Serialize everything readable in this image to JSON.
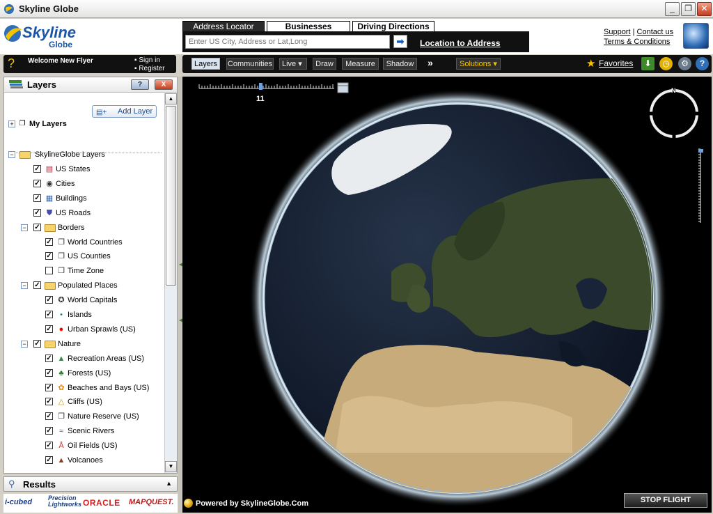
{
  "window": {
    "title": "Skyline Globe",
    "buttons": [
      "_",
      "❐",
      "✕"
    ]
  },
  "logo": {
    "brand": "Skyline",
    "sub": "Globe"
  },
  "search_tabs": [
    {
      "label": "Address Locator",
      "active": true
    },
    {
      "label": "Businesses",
      "active": false
    },
    {
      "label": "Driving Directions",
      "active": false
    }
  ],
  "address": {
    "placeholder": "Enter US City, Address or Lat,Long",
    "go": "➡",
    "link": "Location to Address"
  },
  "header_links": {
    "support": "Support",
    "separator": "|",
    "contact": "Contact us",
    "terms": "Terms & Conditions"
  },
  "welcome": {
    "text": "Welcome New Flyer",
    "sign_in": "Sign in",
    "register": "Register"
  },
  "toolbar": {
    "buttons": [
      "Layers",
      "Communities",
      "Live",
      "Draw",
      "Measure",
      "Shadow"
    ],
    "active": "Layers",
    "more": "»",
    "solutions": "Solutions",
    "favorites": "Favorites",
    "icons": [
      "download-icon",
      "clock-icon",
      "tools-icon",
      "help-icon"
    ]
  },
  "layers_panel": {
    "title": "Layers",
    "help_btn": "?",
    "close_btn": "X",
    "add_layer": "Add Layer",
    "my_layers": "My Layers",
    "root": "SkylineGlobe Layers",
    "items": [
      {
        "label": "US States",
        "checked": true,
        "icon": "us-flag-icon",
        "level": 1
      },
      {
        "label": "Cities",
        "checked": true,
        "icon": "target-icon",
        "level": 1
      },
      {
        "label": "Buildings",
        "checked": true,
        "icon": "building-icon",
        "level": 1
      },
      {
        "label": "US Roads",
        "checked": true,
        "icon": "shield-icon",
        "level": 1
      },
      {
        "label": "Borders",
        "checked": true,
        "icon": "folder-icon",
        "level": 1,
        "group": true
      },
      {
        "label": "World Countries",
        "checked": true,
        "icon": "layer-icon",
        "level": 2
      },
      {
        "label": "US Counties",
        "checked": true,
        "icon": "layer-icon",
        "level": 2
      },
      {
        "label": "Time Zone",
        "checked": false,
        "icon": "layer-icon",
        "level": 2
      },
      {
        "label": "Populated Places",
        "checked": true,
        "icon": "folder-icon",
        "level": 1,
        "group": true
      },
      {
        "label": "World Capitals",
        "checked": true,
        "icon": "star-icon",
        "level": 2
      },
      {
        "label": "Islands",
        "checked": true,
        "icon": "dot-icon",
        "level": 2
      },
      {
        "label": "Urban Sprawls (US)",
        "checked": true,
        "icon": "red-blob-icon",
        "level": 2
      },
      {
        "label": "Nature",
        "checked": true,
        "icon": "folder-icon",
        "level": 1,
        "group": true
      },
      {
        "label": "Recreation Areas (US)",
        "checked": true,
        "icon": "recreation-icon",
        "level": 2
      },
      {
        "label": "Forests (US)",
        "checked": true,
        "icon": "tree-icon",
        "level": 2
      },
      {
        "label": "Beaches and Bays (US)",
        "checked": true,
        "icon": "beach-icon",
        "level": 2
      },
      {
        "label": "Cliffs (US)",
        "checked": true,
        "icon": "cliff-icon",
        "level": 2
      },
      {
        "label": "Nature Reserve (US)",
        "checked": true,
        "icon": "layer-icon",
        "level": 2
      },
      {
        "label": "Scenic Rivers",
        "checked": true,
        "icon": "river-icon",
        "level": 2
      },
      {
        "label": "Oil Fields (US)",
        "checked": true,
        "icon": "oil-icon",
        "level": 2
      },
      {
        "label": "Volcanoes",
        "checked": true,
        "icon": "volcano-icon",
        "level": 2
      }
    ]
  },
  "results": {
    "title": "Results"
  },
  "sponsors": [
    "i-cubed",
    "Precision Lightworks",
    "ORACLE",
    "MAPQUEST."
  ],
  "map": {
    "zoom_level": "11",
    "powered_by": "Powered by SkylineGlobe.Com",
    "stop_button": "STOP FLIGHT",
    "compass_north": "N"
  }
}
